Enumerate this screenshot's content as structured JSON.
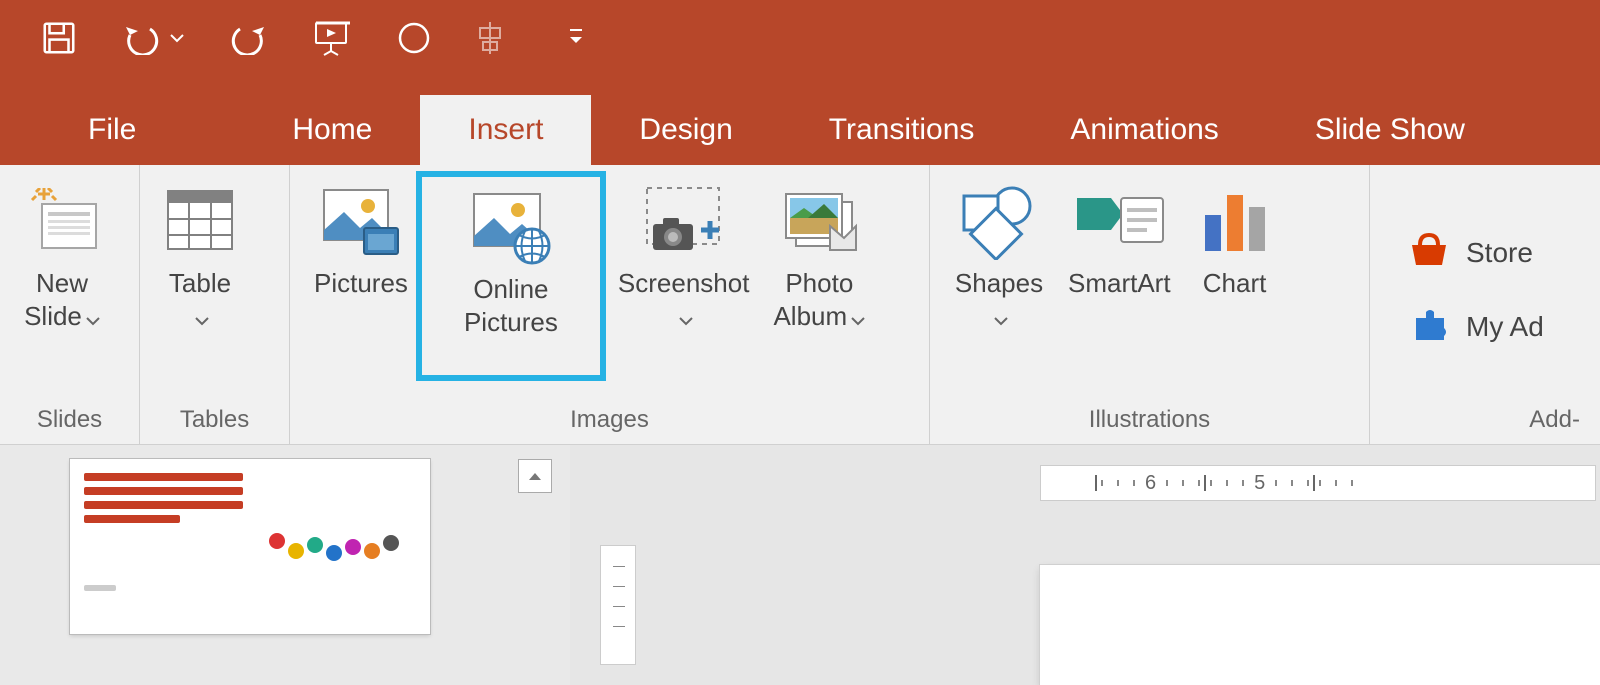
{
  "qat": {
    "save": "save",
    "undo": "undo",
    "redo": "redo",
    "slideshow": "from-beginning",
    "circle": "start-recording",
    "align": "touch-mouse-mode",
    "more": "customize"
  },
  "tabs": {
    "file": "File",
    "home": "Home",
    "insert": "Insert",
    "design": "Design",
    "transitions": "Transitions",
    "animations": "Animations",
    "slideshow": "Slide Show",
    "active": "insert"
  },
  "ribbon": {
    "groups": {
      "slides": {
        "label": "Slides",
        "new_slide": "New\nSlide"
      },
      "tables": {
        "label": "Tables",
        "table": "Table"
      },
      "images": {
        "label": "Images",
        "pictures": "Pictures",
        "online_pictures": "Online\nPictures",
        "screenshot": "Screenshot",
        "photo_album": "Photo\nAlbum"
      },
      "illustrations": {
        "label": "Illustrations",
        "shapes": "Shapes",
        "smartart": "SmartArt",
        "chart": "Chart"
      },
      "addins": {
        "label": "Add-",
        "store": "Store",
        "my_addins": "My Ad"
      }
    }
  },
  "ruler": {
    "marks": [
      "6",
      "5"
    ]
  },
  "thumb": {
    "balloon_colors": [
      "#d33",
      "#e8b400",
      "#2a8",
      "#2373c9",
      "#c024b1",
      "#e67e22",
      "#555"
    ]
  }
}
